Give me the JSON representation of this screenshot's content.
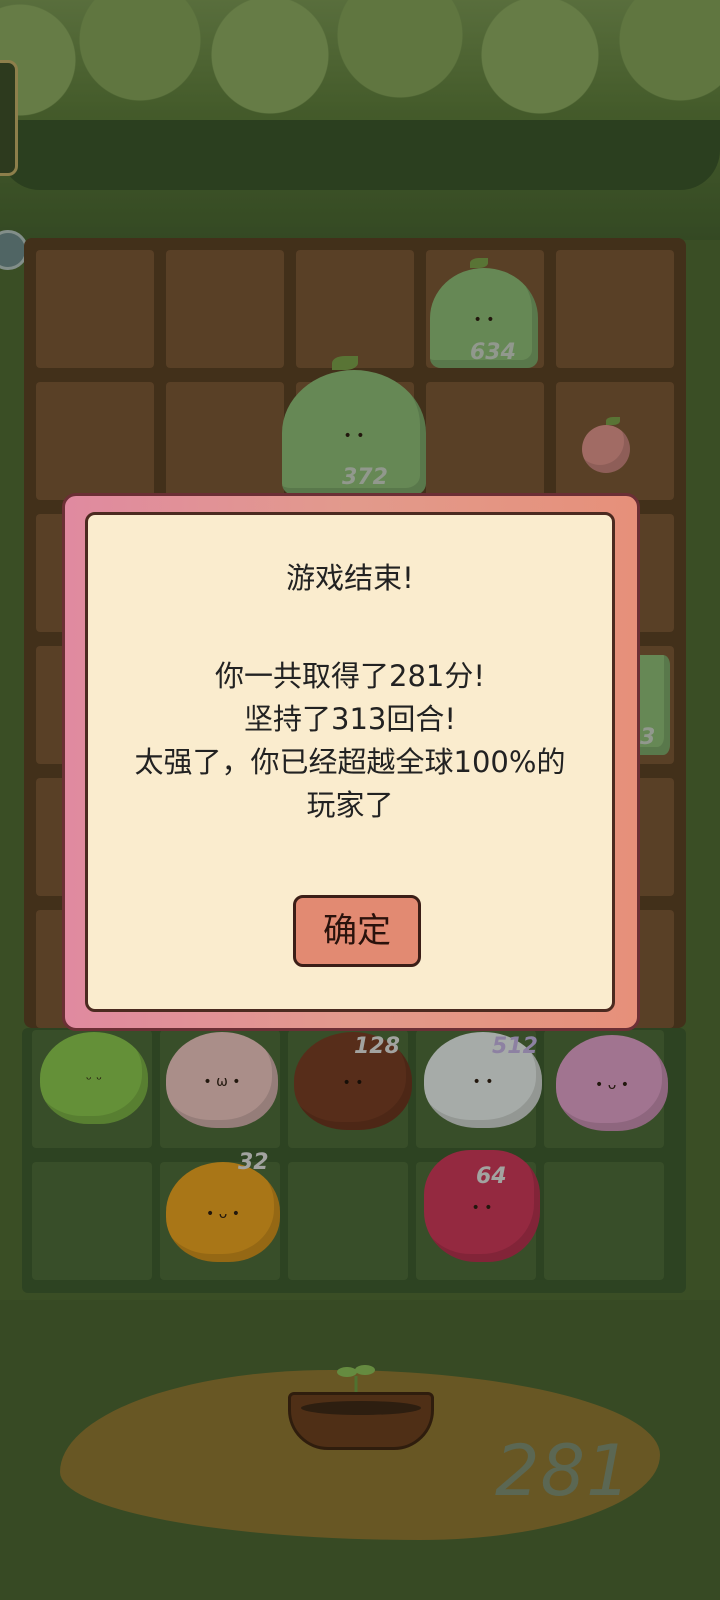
{
  "dialog": {
    "title": "游戏结束!",
    "line1": "你一共取得了281分!",
    "line2": "坚持了313回合!",
    "line3": "太强了，你已经超越全球100%的",
    "line4": "玩家了",
    "confirm_label": "确定"
  },
  "board": {
    "fruit_numbers": [
      "634",
      "372",
      "3",
      "128",
      "512",
      "32",
      "64"
    ]
  },
  "score_display": "281",
  "colors": {
    "modal_frame": "#e29a8c",
    "modal_bg": "#faecce",
    "confirm_button": "#e28a72"
  }
}
